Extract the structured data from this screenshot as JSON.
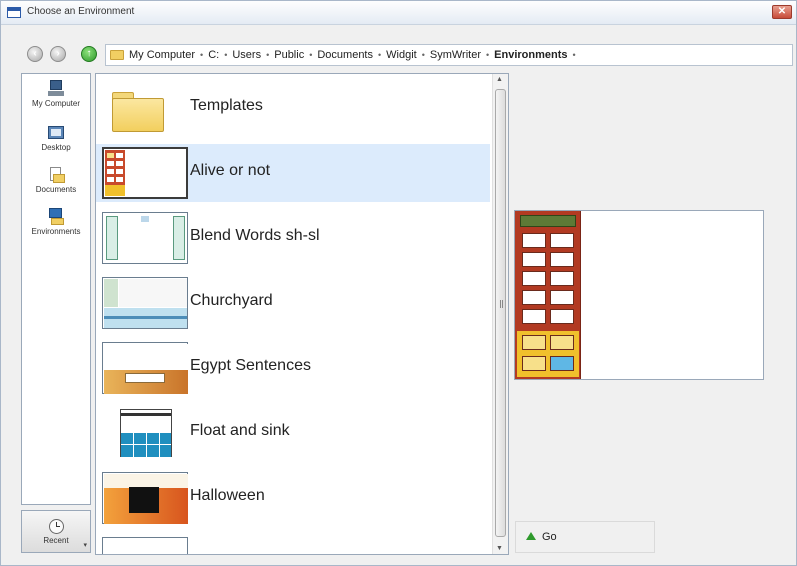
{
  "window": {
    "title": "Choose an Environment",
    "close_glyph": "✕"
  },
  "nav": {
    "back_icon": "back-arrow-icon",
    "forward_icon": "forward-arrow-icon",
    "up_icon": "up-arrow-icon",
    "crumbs": [
      "My Computer",
      "C:",
      "Users",
      "Public",
      "Documents",
      "Widgit",
      "SymWriter",
      "Environments"
    ],
    "separator": "•"
  },
  "places": {
    "items": [
      {
        "label": "My Computer",
        "icon": "computer-icon"
      },
      {
        "label": "Desktop",
        "icon": "desktop-icon"
      },
      {
        "label": "Documents",
        "icon": "documents-icon"
      },
      {
        "label": "Environments",
        "icon": "environments-icon"
      }
    ],
    "recent_label": "Recent"
  },
  "files": {
    "items": [
      {
        "name": "Templates",
        "kind": "folder"
      },
      {
        "name": "Alive or not",
        "kind": "environment",
        "selected": true
      },
      {
        "name": "Blend Words sh-sl",
        "kind": "environment"
      },
      {
        "name": "Churchyard",
        "kind": "environment"
      },
      {
        "name": "Egypt Sentences",
        "kind": "environment"
      },
      {
        "name": "Float and sink",
        "kind": "environment"
      },
      {
        "name": "Halloween",
        "kind": "environment"
      }
    ]
  },
  "preview": {
    "go_label": "Go"
  },
  "colors": {
    "selection": "#dcebfc",
    "palette_red": "#b23a22",
    "palette_yellow": "#f0c02c",
    "go_green": "#2e9a2c"
  }
}
